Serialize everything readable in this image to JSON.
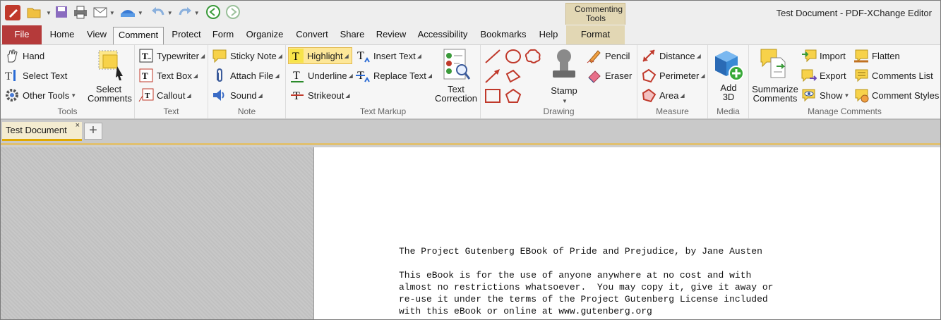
{
  "app": {
    "title": "Test Document - PDF-XChange Editor",
    "contextual_group": "Commenting Tools"
  },
  "quick_access": [
    "app-icon",
    "open-icon",
    "save-icon",
    "print-icon",
    "email-icon",
    "scan-icon",
    "undo-icon",
    "redo-icon",
    "back-icon",
    "forward-icon"
  ],
  "menu": {
    "file": "File",
    "home": "Home",
    "view": "View",
    "comment": "Comment",
    "protect": "Protect",
    "form": "Form",
    "organize": "Organize",
    "convert": "Convert",
    "share": "Share",
    "review": "Review",
    "accessibility": "Accessibility",
    "bookmarks": "Bookmarks",
    "help": "Help",
    "format": "Format"
  },
  "ribbon": {
    "tools": {
      "label": "Tools",
      "hand": "Hand",
      "select_text": "Select Text",
      "other_tools": "Other Tools",
      "select_comments": "Select Comments"
    },
    "text": {
      "label": "Text",
      "typewriter": "Typewriter",
      "text_box": "Text Box",
      "callout": "Callout"
    },
    "note": {
      "label": "Note",
      "sticky_note": "Sticky Note",
      "attach_file": "Attach File",
      "sound": "Sound"
    },
    "markup": {
      "label": "Text Markup",
      "highlight": "Highlight",
      "underline": "Underline",
      "strikeout": "Strikeout",
      "insert_text": "Insert Text",
      "replace_text": "Replace Text",
      "text_correction": "Text Correction"
    },
    "drawing": {
      "label": "Drawing",
      "stamp": "Stamp",
      "pencil": "Pencil",
      "eraser": "Eraser"
    },
    "measure": {
      "label": "Measure",
      "distance": "Distance",
      "perimeter": "Perimeter",
      "area": "Area"
    },
    "media": {
      "label": "Media",
      "add_3d": "Add 3D"
    },
    "manage": {
      "label": "Manage Comments",
      "summarize": "Summarize Comments",
      "import": "Import",
      "export": "Export",
      "show": "Show",
      "flatten": "Flatten",
      "comments_list": "Comments List",
      "comment_styles": "Comment Styles"
    }
  },
  "tabs": {
    "document": "Test Document",
    "close": "×",
    "new": "+"
  },
  "document": {
    "lines": [
      "The Project Gutenberg EBook of Pride and Prejudice, by Jane Austen",
      "",
      "This eBook is for the use of anyone anywhere at no cost and with",
      "almost no restrictions whatsoever.  You may copy it, give it away or",
      "re-use it under the terms of the Project Gutenberg License included",
      "with this eBook or online at www.gutenberg.org"
    ]
  },
  "colors": {
    "file_tab": "#b53a3a",
    "context_tab": "#e2d7b4",
    "highlight_selected": "#fde798",
    "active_doc_tab": "#f4ecd0",
    "accent": "#e0a800"
  }
}
